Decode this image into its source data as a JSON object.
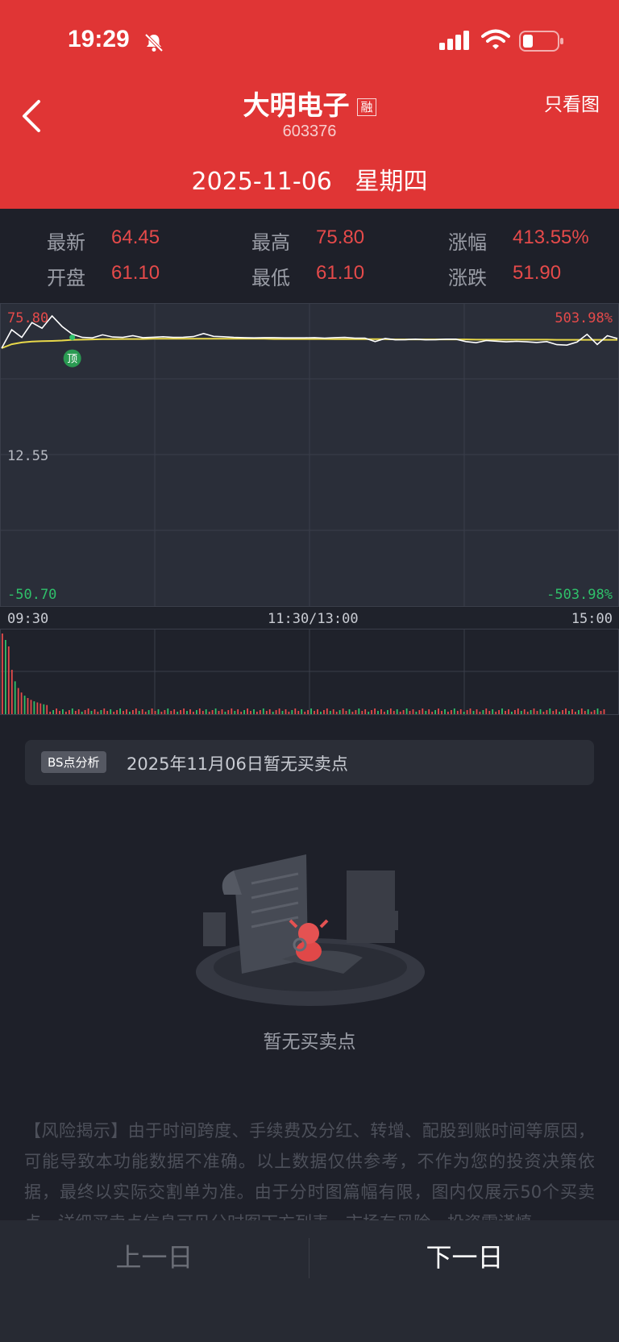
{
  "status_bar": {
    "time": "19:29"
  },
  "header": {
    "title": "大明电子",
    "tag": "融",
    "code": "603376",
    "right_action": "只看图",
    "date": "2025-11-06",
    "weekday": "星期四"
  },
  "stats": [
    {
      "label": "最新",
      "value": "64.45"
    },
    {
      "label": "最高",
      "value": "75.80"
    },
    {
      "label": "涨幅",
      "value": "413.55%"
    },
    {
      "label": "开盘",
      "value": "61.10"
    },
    {
      "label": "最低",
      "value": "61.10"
    },
    {
      "label": "涨跌",
      "value": "51.90"
    }
  ],
  "chart_data": {
    "type": "line",
    "price_axis": {
      "top": "75.80",
      "mid": "12.55",
      "bottom": "-50.70"
    },
    "pct_axis": {
      "top": "503.98%",
      "bottom": "-503.98%"
    },
    "time_labels": [
      "09:30",
      "11:30/13:00",
      "15:00"
    ],
    "marker": "顶",
    "ylim": [
      -50.7,
      75.8
    ],
    "series": [
      {
        "values": [
          61.1,
          69.5,
          66.0,
          72.8,
          70.2,
          75.8,
          71.0,
          67.5,
          66.0,
          65.8,
          67.2,
          66.2,
          66.0,
          66.8,
          65.9,
          66.1,
          66.3,
          66.0,
          66.1,
          66.4,
          67.8,
          66.5,
          66.3,
          66.0,
          65.9,
          65.8,
          65.9,
          65.9,
          65.8,
          65.8,
          65.8,
          65.9,
          65.7,
          65.9,
          66.0,
          65.7,
          65.7,
          64.1,
          65.5,
          64.9,
          65.0,
          65.2,
          64.9,
          65.0,
          65.2,
          65.2,
          64.1,
          63.6,
          64.6,
          64.3,
          64.0,
          64.2,
          64.0,
          63.7,
          64.1,
          62.7,
          62.5,
          63.9,
          67.4,
          62.8,
          66.8,
          65.5
        ]
      },
      {
        "values": [
          61.1,
          62.9,
          63.7,
          64.1,
          64.3,
          64.4,
          64.6,
          64.9,
          65.0,
          65.1,
          65.2,
          65.2,
          65.3,
          65.3,
          65.3,
          65.4,
          65.4,
          65.4,
          65.4,
          65.4,
          65.4,
          65.4,
          65.4,
          65.4,
          65.4,
          65.4,
          65.4,
          65.3,
          65.3,
          65.3,
          65.3,
          65.3,
          65.3,
          65.2,
          65.2,
          65.2,
          65.2,
          65.2,
          65.2,
          65.1,
          65.1,
          65.1,
          65.1,
          65.1,
          65.1,
          65.1,
          65.1,
          65.0,
          65.0,
          65.0,
          65.0,
          65.0,
          65.0,
          65.0,
          65.0,
          64.9,
          64.9,
          64.9,
          64.9,
          64.9,
          64.9,
          64.9
        ]
      }
    ]
  },
  "bs_analysis": {
    "tag": "BS点分析",
    "text": "2025年11月06日暂无买卖点"
  },
  "empty_state": {
    "text": "暂无买卖点"
  },
  "risk_notice": "【风险揭示】由于时间跨度、手续费及分红、转增、配股到账时间等原因，可能导致本功能数据不准确。以上数据仅供参考，不作为您的投资决策依据，最终以实际交割单为准。由于分时图篇幅有限，图内仅展示50个买卖点，详细买卖点信息可见分时图下方列表。市场有风险，投资需谨慎。",
  "bottom_nav": {
    "prev": "上一日",
    "next": "下一日"
  },
  "colors": {
    "header": "#e03535",
    "up": "#e54a4a",
    "down": "#2fc06a",
    "avg_line": "#e8d84a"
  }
}
